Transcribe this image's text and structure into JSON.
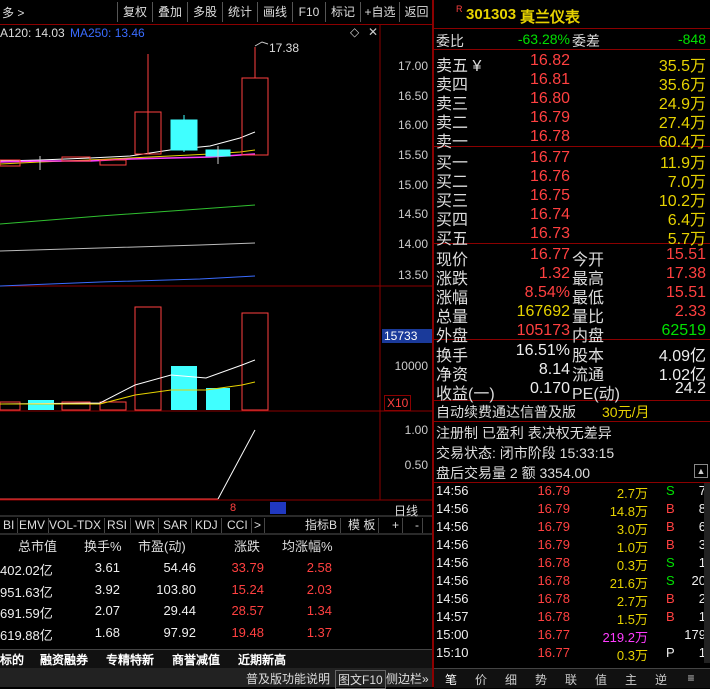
{
  "toolbar": {
    "left_label": "多 >",
    "buttons": [
      "复权",
      "叠加",
      "多股",
      "统计",
      "画线",
      "F10",
      "标记",
      "+自选",
      "返回"
    ]
  },
  "ma_legend": {
    "ma120": "A120: 14.03",
    "ma250": "MA250: 13.46"
  },
  "price_axis": [
    "17.00",
    "16.50",
    "16.00",
    "15.50",
    "15.00",
    "14.50",
    "14.00",
    "13.50"
  ],
  "high_label": "17.38",
  "vol_axis": {
    "current": "15733",
    "mid": "10000",
    "unit": "X10"
  },
  "ind_axis": [
    "1.00",
    "0.50"
  ],
  "ind_marker": "8",
  "period_label": "日线",
  "indicator_tabs": [
    "BI",
    "EMV",
    "VOL-TDX",
    "RSI",
    "WR",
    "SAR",
    "KDJ",
    "CCI",
    ">"
  ],
  "indicator_right": [
    "指标B",
    "模 板",
    "+",
    "-"
  ],
  "sector_table": {
    "headers": [
      "总市值",
      "换手%",
      "市盈(动)",
      "涨跌",
      "均涨幅%"
    ],
    "rows": [
      [
        "402.02亿",
        "3.61",
        "54.46",
        "33.79",
        "2.58"
      ],
      [
        "951.63亿",
        "3.92",
        "103.80",
        "15.24",
        "2.03"
      ],
      [
        "691.59亿",
        "2.07",
        "29.44",
        "28.57",
        "1.34"
      ],
      [
        "619.88亿",
        "1.68",
        "97.92",
        "19.48",
        "1.37"
      ]
    ]
  },
  "bottom_tabs": [
    "标的",
    "融资融券",
    "专精特新",
    "商誉减值",
    "近期新高"
  ],
  "bottom_bar": {
    "left": "普及版功能说明",
    "btn1": "图文F10",
    "btn2": "侧边栏»"
  },
  "stock": {
    "code": "301303",
    "name": "真兰仪表",
    "flag": "R"
  },
  "weibi": {
    "label": "委比",
    "value": "-63.28%",
    "label2": "委差",
    "value2": "-848"
  },
  "asks": [
    {
      "label": "卖五 ¥",
      "price": "16.82",
      "vol": "35.5万"
    },
    {
      "label": "卖四",
      "price": "16.81",
      "vol": "35.6万"
    },
    {
      "label": "卖三",
      "price": "16.80",
      "vol": "24.9万"
    },
    {
      "label": "卖二",
      "price": "16.79",
      "vol": "27.4万"
    },
    {
      "label": "卖一",
      "price": "16.78",
      "vol": "60.4万"
    }
  ],
  "bids": [
    {
      "label": "买一",
      "price": "16.77",
      "vol": "11.9万"
    },
    {
      "label": "买二",
      "price": "16.76",
      "vol": "7.0万"
    },
    {
      "label": "买三",
      "price": "16.75",
      "vol": "10.2万"
    },
    {
      "label": "买四",
      "price": "16.74",
      "vol": "6.4万"
    },
    {
      "label": "买五",
      "price": "16.73",
      "vol": "5.7万"
    }
  ],
  "quote": [
    {
      "l1": "现价",
      "v1": "16.77",
      "l2": "今开",
      "v2": "15.51"
    },
    {
      "l1": "涨跌",
      "v1": "1.32",
      "l2": "最高",
      "v2": "17.38"
    },
    {
      "l1": "涨幅",
      "v1": "8.54%",
      "l2": "最低",
      "v2": "15.51"
    },
    {
      "l1": "总量",
      "v1": "167692",
      "l2": "量比",
      "v2": "2.33"
    },
    {
      "l1": "外盘",
      "v1": "105173",
      "l2": "内盘",
      "v2": "62519"
    }
  ],
  "fundamentals": [
    {
      "l1": "换手",
      "v1": "16.51%",
      "l2": "股本",
      "v2": "4.09亿"
    },
    {
      "l1": "净资",
      "v1": "8.14",
      "l2": "流通",
      "v2": "1.02亿"
    },
    {
      "l1": "收益(一)",
      "v1": "0.170",
      "l2": "PE(动)",
      "v2": "24.2"
    }
  ],
  "promo": {
    "text": "自动续费通达信普及版",
    "price": "30元/月"
  },
  "info": {
    "line1": "注册制 已盈利 表决权无差异",
    "line2": "交易状态: 闭市阶段 15:33:15",
    "line3": "盘后交易量 2 额 3354.00"
  },
  "ticks": [
    {
      "time": "14:56",
      "price": "16.79",
      "vol": "2.7万",
      "side": "S",
      "n": "7"
    },
    {
      "time": "14:56",
      "price": "16.79",
      "vol": "14.8万",
      "side": "B",
      "n": "8"
    },
    {
      "time": "14:56",
      "price": "16.79",
      "vol": "3.0万",
      "side": "B",
      "n": "6"
    },
    {
      "time": "14:56",
      "price": "16.79",
      "vol": "1.0万",
      "side": "B",
      "n": "3"
    },
    {
      "time": "14:56",
      "price": "16.78",
      "vol": "0.3万",
      "side": "S",
      "n": "1"
    },
    {
      "time": "14:56",
      "price": "16.78",
      "vol": "21.6万",
      "side": "S",
      "n": "20"
    },
    {
      "time": "14:56",
      "price": "16.78",
      "vol": "2.7万",
      "side": "B",
      "n": "2"
    },
    {
      "time": "14:57",
      "price": "16.78",
      "vol": "1.5万",
      "side": "B",
      "n": "1"
    },
    {
      "time": "15:00",
      "price": "16.77",
      "vol": "219.2万",
      "side": "",
      "n": "179"
    },
    {
      "time": "15:10",
      "price": "16.77",
      "vol": "0.3万",
      "side": "P",
      "n": "1"
    }
  ],
  "bottom_nav": [
    "笔",
    "价",
    "细",
    "势",
    "联",
    "值",
    "主",
    "逆",
    "≡"
  ],
  "colors": {
    "up": "#ff4040",
    "down": "#00e0e0",
    "border": "#8b0000",
    "accent": "#e6d200"
  }
}
